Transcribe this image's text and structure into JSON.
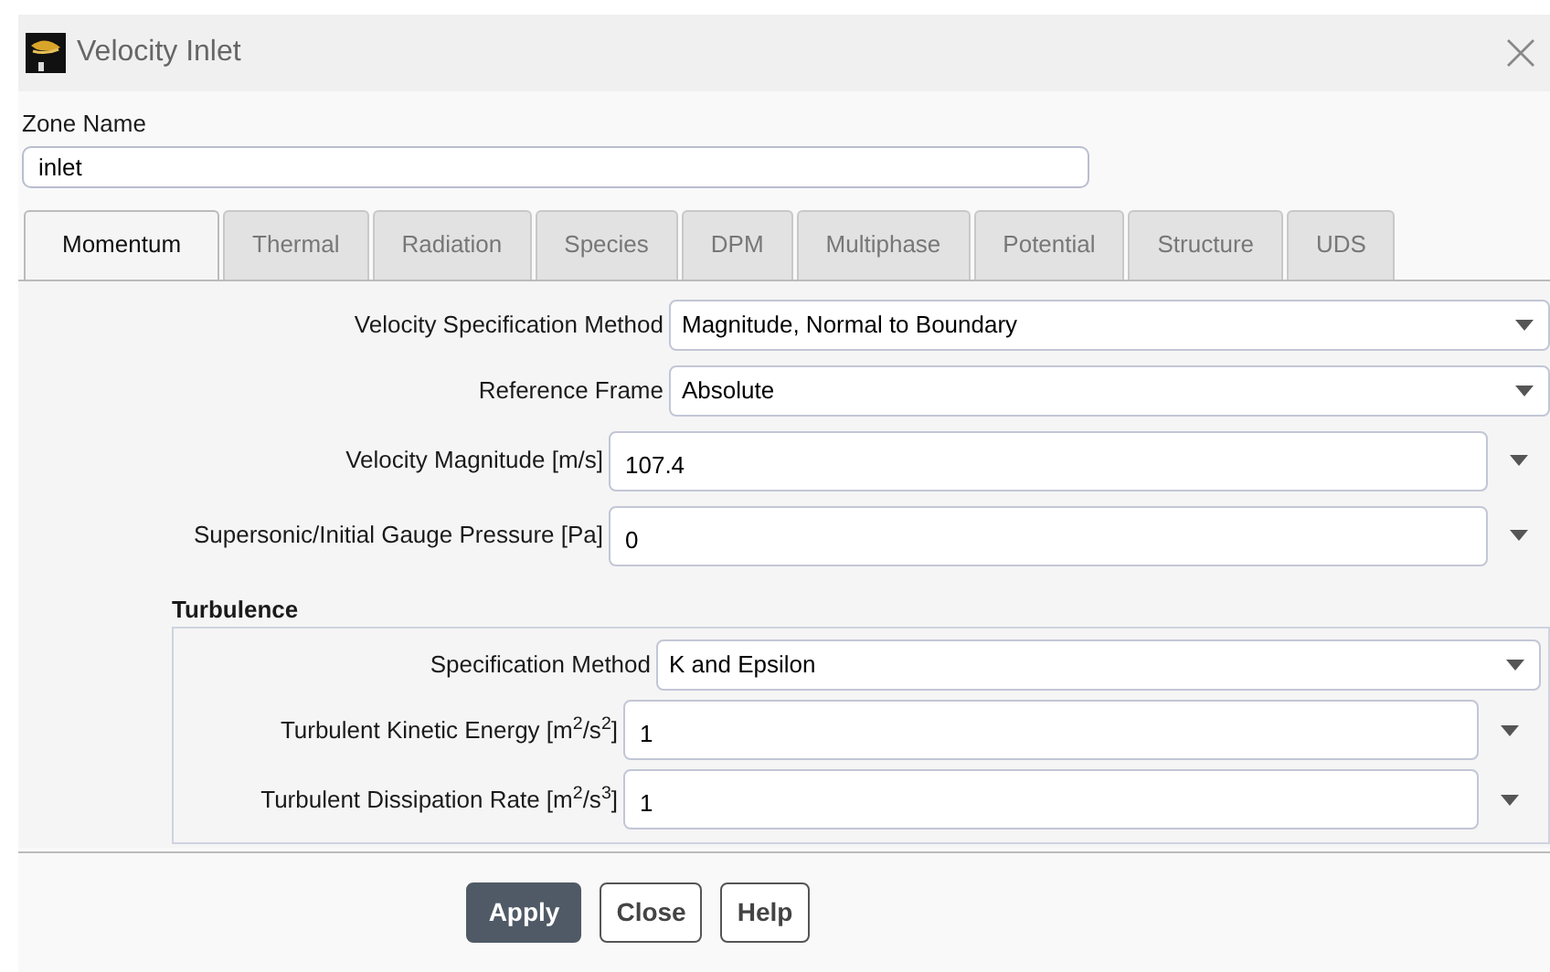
{
  "window": {
    "title": "Velocity Inlet"
  },
  "zone_name": {
    "label": "Zone Name",
    "value": "inlet"
  },
  "tabs": [
    {
      "label": "Momentum",
      "selected": true
    },
    {
      "label": "Thermal",
      "selected": false
    },
    {
      "label": "Radiation",
      "selected": false
    },
    {
      "label": "Species",
      "selected": false
    },
    {
      "label": "DPM",
      "selected": false
    },
    {
      "label": "Multiphase",
      "selected": false
    },
    {
      "label": "Potential",
      "selected": false
    },
    {
      "label": "Structure",
      "selected": false
    },
    {
      "label": "UDS",
      "selected": false
    }
  ],
  "fields": [
    {
      "kind": "select",
      "label": "Velocity Specification Method",
      "value": "Magnitude, Normal to Boundary"
    },
    {
      "kind": "select",
      "label": "Reference Frame",
      "value": "Absolute"
    },
    {
      "kind": "input",
      "label": "Velocity Magnitude [m/s]",
      "value": "107.4"
    },
    {
      "kind": "input",
      "label": "Supersonic/Initial Gauge Pressure [Pa]",
      "value": "0"
    }
  ],
  "turbulence": {
    "title": "Turbulence",
    "fields": [
      {
        "kind": "select",
        "label": "Specification Method",
        "value": "K and Epsilon"
      },
      {
        "kind": "input",
        "label": "Turbulent Kinetic Energy [m$^{2}$/s$^{2}$]",
        "value": "1"
      },
      {
        "kind": "input",
        "label": "Turbulent Dissipation Rate [m$^{2}$/s$^{3}$]",
        "value": "1"
      }
    ]
  },
  "buttons": [
    {
      "label": "Apply",
      "primary": true
    },
    {
      "label": "Close",
      "primary": false
    },
    {
      "label": "Help",
      "primary": false
    }
  ]
}
